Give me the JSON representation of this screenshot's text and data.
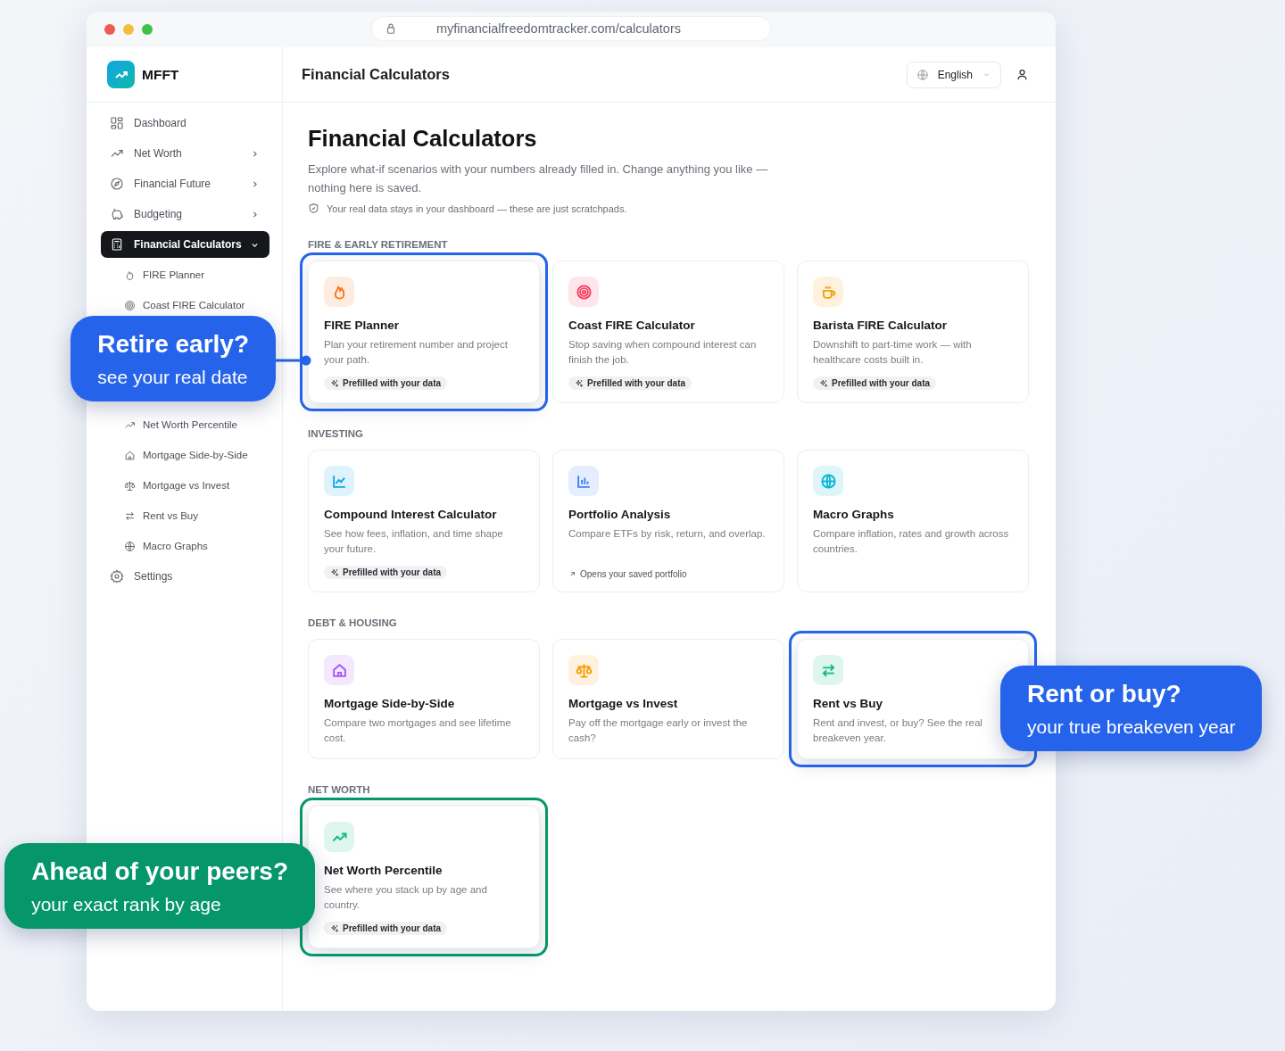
{
  "browser": {
    "url": "myfinancialfreedomtracker.com/calculators"
  },
  "app": {
    "logo": "MFFT"
  },
  "sidebar": {
    "items": [
      {
        "label": "Dashboard",
        "selected": false
      },
      {
        "label": "Net Worth",
        "selected": false,
        "expanded": false
      },
      {
        "label": "Financial Future",
        "selected": false,
        "expanded": false
      },
      {
        "label": "Budgeting",
        "selected": false,
        "expanded": false
      },
      {
        "label": "Financial Calculators",
        "selected": true,
        "expanded": true,
        "children": [
          {
            "label": "FIRE Planner"
          },
          {
            "label": "Coast FIRE Calculator"
          },
          {
            "label": "Net Worth Percentile"
          },
          {
            "label": "Mortgage Side-by-Side"
          },
          {
            "label": "Mortgage vs Invest"
          },
          {
            "label": "Rent vs Buy"
          },
          {
            "label": "Macro Graphs"
          }
        ]
      },
      {
        "label": "Settings",
        "selected": false
      }
    ]
  },
  "header": {
    "title": "Financial Calculators",
    "language": "English"
  },
  "page": {
    "title": "Financial Calculators",
    "description": "Explore what-if scenarios with your numbers already filled in. Change anything you like — nothing here is saved.",
    "note": "Your real data stays in your dashboard — these are just scratchpads."
  },
  "sections": [
    {
      "label": "FIRE & EARLY RETIREMENT",
      "cards": [
        {
          "title": "FIRE Planner",
          "description": "Plan your retirement number and project your path.",
          "color": "#f97316",
          "footer": {
            "kind": "badge",
            "text": "Prefilled with your data"
          },
          "highlight": {
            "color": "#2563eb",
            "callout_title": "Retire early?",
            "callout_subtitle": "see your real date",
            "connector": true
          }
        },
        {
          "title": "Coast FIRE Calculator",
          "description": "Stop saving when compound interest can finish the job.",
          "color": "#f43f5e",
          "footer": {
            "kind": "badge",
            "text": "Prefilled with your data"
          }
        },
        {
          "title": "Barista FIRE Calculator",
          "description": "Downshift to part-time work — with healthcare costs built in.",
          "color": "#f59e0b",
          "footer": {
            "kind": "badge",
            "text": "Prefilled with your data"
          }
        }
      ]
    },
    {
      "label": "INVESTING",
      "cards": [
        {
          "title": "Compound Interest Calculator",
          "description": "See how fees, inflation, and time shape your future.",
          "color": "#0ea5e9",
          "footer": {
            "kind": "badge",
            "text": "Prefilled with your data"
          }
        },
        {
          "title": "Portfolio Analysis",
          "description": "Compare ETFs by risk, return, and overlap.",
          "color": "#3b82f6",
          "footer": {
            "kind": "link",
            "text": "Opens your saved portfolio"
          }
        },
        {
          "title": "Macro Graphs",
          "description": "Compare inflation, rates and growth across countries.",
          "color": "#06b6d4"
        }
      ]
    },
    {
      "label": "DEBT & HOUSING",
      "cards": [
        {
          "title": "Mortgage Side-by-Side",
          "description": "Compare two mortgages and see lifetime cost.",
          "color": "#a855f7"
        },
        {
          "title": "Mortgage vs Invest",
          "description": "Pay off the mortgage early or invest the cash?",
          "color": "#f59e0b"
        },
        {
          "title": "Rent vs Buy",
          "description": "Rent and invest, or buy? See the real breakeven year.",
          "color": "#10b981",
          "highlight": {
            "color": "#2563eb",
            "callout_title": "Rent or buy?",
            "callout_subtitle": "your true breakeven year",
            "connector": false
          }
        }
      ]
    },
    {
      "label": "NET WORTH",
      "cards": [
        {
          "title": "Net Worth Percentile",
          "description": "See where you stack up by age and country.",
          "color": "#10b981",
          "footer": {
            "kind": "badge",
            "text": "Prefilled with your data"
          },
          "highlight": {
            "color": "#059669",
            "callout_title": "Ahead of your peers?",
            "callout_subtitle": "your exact rank by age",
            "connector": false
          }
        }
      ]
    }
  ]
}
